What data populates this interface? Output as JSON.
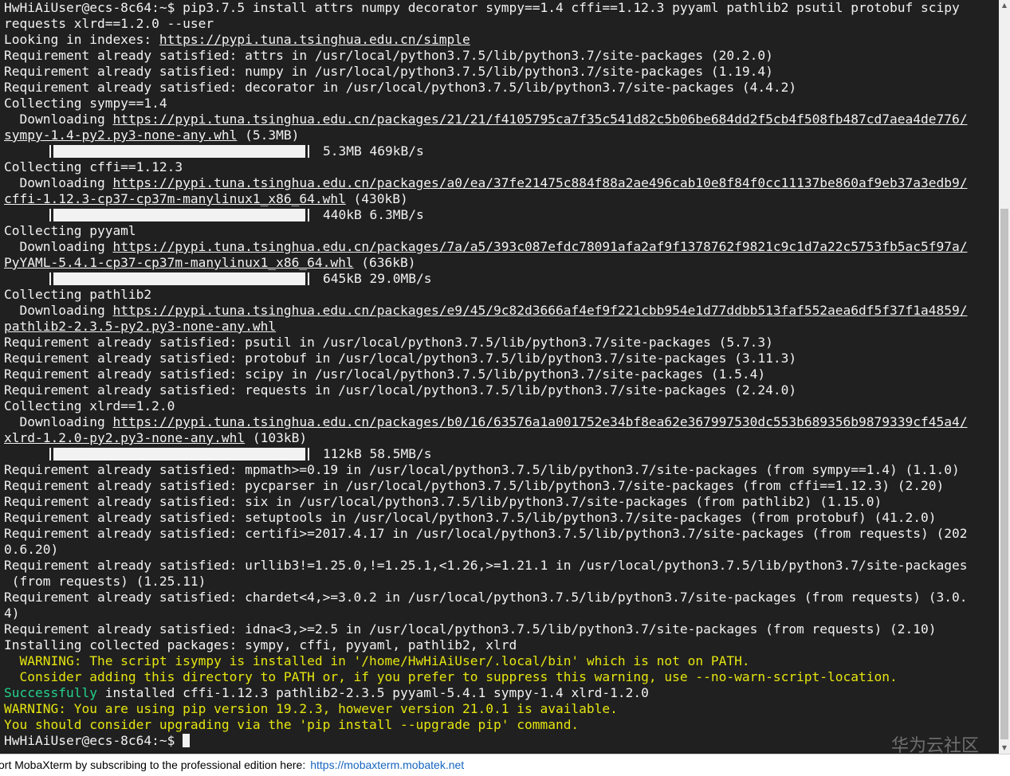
{
  "terminal": {
    "lines": [
      {
        "type": "text",
        "text": "HwHiAiUser@ecs-8c64:~$ pip3.7.5 install attrs numpy decorator sympy==1.4 cffi==1.12.3 pyyaml pathlib2 psutil protobuf scipy"
      },
      {
        "type": "text",
        "text": "requests xlrd==1.2.0 --user"
      },
      {
        "type": "link",
        "pre": "Looking in indexes: ",
        "link": "https://pypi.tuna.tsinghua.edu.cn/simple",
        "post": ""
      },
      {
        "type": "text",
        "text": "Requirement already satisfied: attrs in /usr/local/python3.7.5/lib/python3.7/site-packages (20.2.0)"
      },
      {
        "type": "text",
        "text": "Requirement already satisfied: numpy in /usr/local/python3.7.5/lib/python3.7/site-packages (1.19.4)"
      },
      {
        "type": "text",
        "text": "Requirement already satisfied: decorator in /usr/local/python3.7.5/lib/python3.7/site-packages (4.4.2)"
      },
      {
        "type": "text",
        "text": "Collecting sympy==1.4"
      },
      {
        "type": "link",
        "pre": "  Downloading ",
        "link": "https://pypi.tuna.tsinghua.edu.cn/packages/21/21/f4105795ca7f35c541d82c5b06be684dd2f5cb4f508fb487cd7aea4de776/",
        "post": ""
      },
      {
        "type": "link",
        "pre": "",
        "link": "sympy-1.4-py2.py3-none-any.whl",
        "post": " (5.3MB)"
      },
      {
        "type": "progress",
        "text": "5.3MB 469kB/s",
        "progress": 1.0
      },
      {
        "type": "text",
        "text": "Collecting cffi==1.12.3"
      },
      {
        "type": "link",
        "pre": "  Downloading ",
        "link": "https://pypi.tuna.tsinghua.edu.cn/packages/a0/ea/37fe21475c884f88a2ae496cab10e8f84f0cc11137be860af9eb37a3edb9/",
        "post": ""
      },
      {
        "type": "link",
        "pre": "",
        "link": "cffi-1.12.3-cp37-cp37m-manylinux1_x86_64.whl",
        "post": " (430kB)"
      },
      {
        "type": "progress",
        "text": "440kB 6.3MB/s",
        "progress": 1.0
      },
      {
        "type": "text",
        "text": "Collecting pyyaml"
      },
      {
        "type": "link",
        "pre": "  Downloading ",
        "link": "https://pypi.tuna.tsinghua.edu.cn/packages/7a/a5/393c087efdc78091afa2af9f1378762f9821c9c1d7a22c5753fb5ac5f97a/",
        "post": ""
      },
      {
        "type": "link",
        "pre": "",
        "link": "PyYAML-5.4.1-cp37-cp37m-manylinux1_x86_64.whl",
        "post": " (636kB)"
      },
      {
        "type": "progress",
        "text": "645kB 29.0MB/s",
        "progress": 1.0
      },
      {
        "type": "text",
        "text": "Collecting pathlib2"
      },
      {
        "type": "link",
        "pre": "  Downloading ",
        "link": "https://pypi.tuna.tsinghua.edu.cn/packages/e9/45/9c82d3666af4ef9f221cbb954e1d77ddbb513faf552aea6df5f37f1a4859/",
        "post": ""
      },
      {
        "type": "link",
        "pre": "",
        "link": "pathlib2-2.3.5-py2.py3-none-any.whl",
        "post": ""
      },
      {
        "type": "text",
        "text": "Requirement already satisfied: psutil in /usr/local/python3.7.5/lib/python3.7/site-packages (5.7.3)"
      },
      {
        "type": "text",
        "text": "Requirement already satisfied: protobuf in /usr/local/python3.7.5/lib/python3.7/site-packages (3.11.3)"
      },
      {
        "type": "text",
        "text": "Requirement already satisfied: scipy in /usr/local/python3.7.5/lib/python3.7/site-packages (1.5.4)"
      },
      {
        "type": "text",
        "text": "Requirement already satisfied: requests in /usr/local/python3.7.5/lib/python3.7/site-packages (2.24.0)"
      },
      {
        "type": "text",
        "text": "Collecting xlrd==1.2.0"
      },
      {
        "type": "link",
        "pre": "  Downloading ",
        "link": "https://pypi.tuna.tsinghua.edu.cn/packages/b0/16/63576a1a001752e34bf8ea62e367997530dc553b689356b9879339cf45a4/",
        "post": ""
      },
      {
        "type": "link",
        "pre": "",
        "link": "xlrd-1.2.0-py2.py3-none-any.whl",
        "post": " (103kB)"
      },
      {
        "type": "progress",
        "text": "112kB 58.5MB/s",
        "progress": 1.0
      },
      {
        "type": "text",
        "text": "Requirement already satisfied: mpmath>=0.19 in /usr/local/python3.7.5/lib/python3.7/site-packages (from sympy==1.4) (1.1.0)"
      },
      {
        "type": "text",
        "text": "Requirement already satisfied: pycparser in /usr/local/python3.7.5/lib/python3.7/site-packages (from cffi==1.12.3) (2.20)"
      },
      {
        "type": "text",
        "text": "Requirement already satisfied: six in /usr/local/python3.7.5/lib/python3.7/site-packages (from pathlib2) (1.15.0)"
      },
      {
        "type": "text",
        "text": "Requirement already satisfied: setuptools in /usr/local/python3.7.5/lib/python3.7/site-packages (from protobuf) (41.2.0)"
      },
      {
        "type": "text",
        "text": "Requirement already satisfied: certifi>=2017.4.17 in /usr/local/python3.7.5/lib/python3.7/site-packages (from requests) (202"
      },
      {
        "type": "text",
        "text": "0.6.20)"
      },
      {
        "type": "text",
        "text": "Requirement already satisfied: urllib3!=1.25.0,!=1.25.1,<1.26,>=1.21.1 in /usr/local/python3.7.5/lib/python3.7/site-packages"
      },
      {
        "type": "text",
        "text": " (from requests) (1.25.11)"
      },
      {
        "type": "text",
        "text": "Requirement already satisfied: chardet<4,>=3.0.2 in /usr/local/python3.7.5/lib/python3.7/site-packages (from requests) (3.0."
      },
      {
        "type": "text",
        "text": "4)"
      },
      {
        "type": "text",
        "text": "Requirement already satisfied: idna<3,>=2.5 in /usr/local/python3.7.5/lib/python3.7/site-packages (from requests) (2.10)"
      },
      {
        "type": "text",
        "text": "Installing collected packages: sympy, cffi, pyyaml, pathlib2, xlrd"
      },
      {
        "type": "warn",
        "text": "  WARNING: The script isympy is installed in '/home/HwHiAiUser/.local/bin' which is not on PATH."
      },
      {
        "type": "warn",
        "text": "  Consider adding this directory to PATH or, if you prefer to suppress this warning, use --no-warn-script-location."
      },
      {
        "type": "success",
        "ok": "Successfully",
        "rest": " installed cffi-1.12.3 pathlib2-2.3.5 pyyaml-5.4.1 sympy-1.4 xlrd-1.2.0"
      },
      {
        "type": "warn",
        "text": "WARNING: You are using pip version 19.2.3, however version 21.0.1 is available."
      },
      {
        "type": "warn",
        "text": "You should consider upgrading via the 'pip install --upgrade pip' command."
      },
      {
        "type": "prompt",
        "text": "HwHiAiUser@ecs-8c64:~$ "
      }
    ]
  },
  "scrollbar": {
    "up_icon": "scroll-up-arrow",
    "down_icon": "scroll-down-arrow"
  },
  "watermark": "华为云社区",
  "statusbar": {
    "text": "ort MobaXterm by subscribing to the professional edition here:",
    "link": "https://mobaxterm.mobatek.net"
  }
}
